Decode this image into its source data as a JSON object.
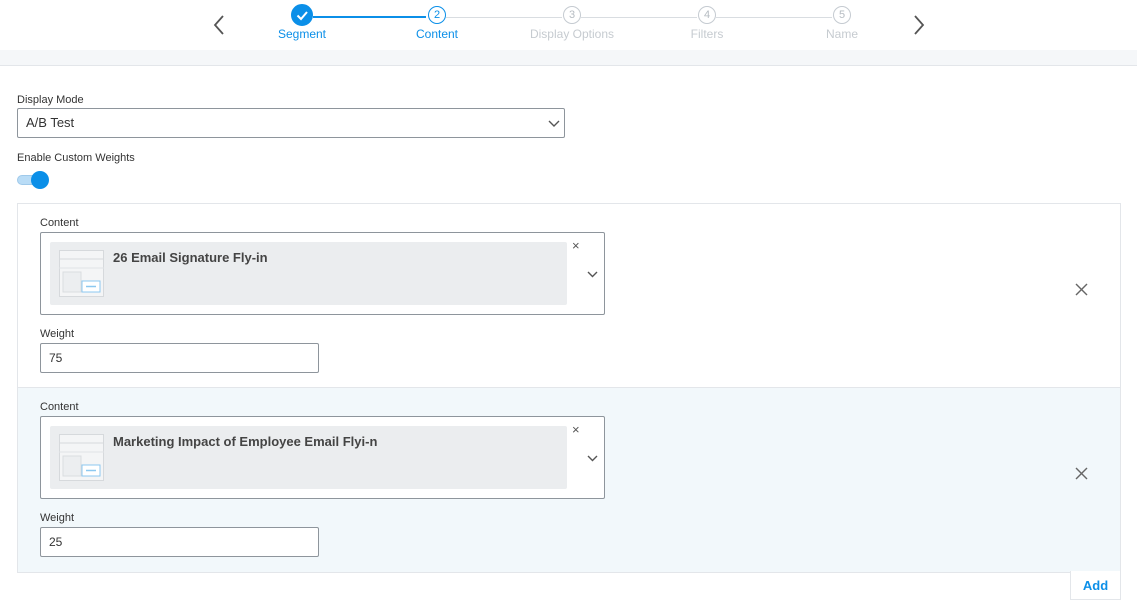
{
  "stepper": {
    "steps": [
      {
        "number": "1",
        "label": "Segment",
        "state": "done"
      },
      {
        "number": "2",
        "label": "Content",
        "state": "active"
      },
      {
        "number": "3",
        "label": "Display Options",
        "state": "todo"
      },
      {
        "number": "4",
        "label": "Filters",
        "state": "todo"
      },
      {
        "number": "5",
        "label": "Name",
        "state": "todo"
      }
    ]
  },
  "form": {
    "display_mode_label": "Display Mode",
    "display_mode_value": "A/B Test",
    "custom_weights_label": "Enable Custom Weights",
    "custom_weights_enabled": true
  },
  "variants": [
    {
      "content_label": "Content",
      "content_title": "26 Email Signature Fly-in",
      "clear_symbol": "×",
      "weight_label": "Weight",
      "weight_value": "75"
    },
    {
      "content_label": "Content",
      "content_title": "Marketing Impact of Employee Email Flyi-n",
      "clear_symbol": "×",
      "weight_label": "Weight",
      "weight_value": "25"
    }
  ],
  "actions": {
    "add_label": "Add"
  },
  "colors": {
    "accent": "#0b8fe8",
    "inactive": "#c6cbd0",
    "highlight_row": "#f2f8fb",
    "border": "#8e959c"
  }
}
